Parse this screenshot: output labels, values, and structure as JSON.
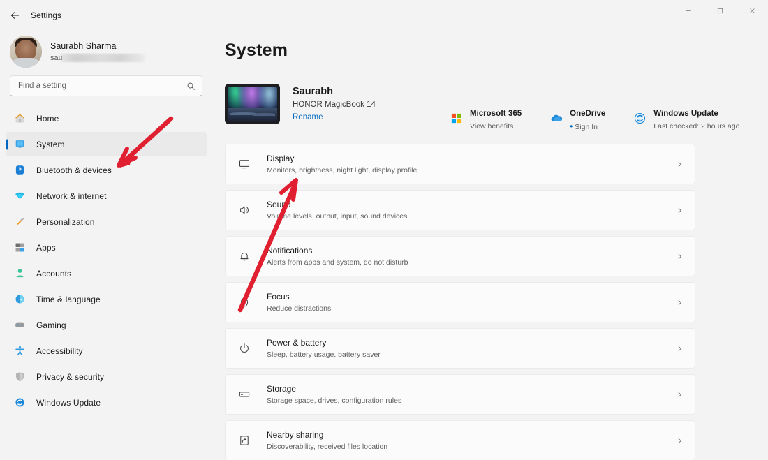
{
  "titlebar": {
    "back_label": "back-arrow",
    "title": "Settings",
    "minimize": "–",
    "maximize": "❐",
    "close": "✕"
  },
  "sidebar": {
    "profile": {
      "name": "Saurabh Sharma",
      "email_visible_prefix": "sau",
      "email_visible_suffix": "n"
    },
    "search": {
      "placeholder": "Find a setting",
      "icon": "search-icon"
    },
    "items": [
      {
        "label": "Home",
        "icon": "home-icon",
        "selected": false
      },
      {
        "label": "System",
        "icon": "system-monitor-icon",
        "selected": true
      },
      {
        "label": "Bluetooth & devices",
        "icon": "bluetooth-icon",
        "selected": false
      },
      {
        "label": "Network & internet",
        "icon": "wifi-icon",
        "selected": false
      },
      {
        "label": "Personalization",
        "icon": "paintbrush-icon",
        "selected": false
      },
      {
        "label": "Apps",
        "icon": "apps-grid-icon",
        "selected": false
      },
      {
        "label": "Accounts",
        "icon": "person-icon",
        "selected": false
      },
      {
        "label": "Time & language",
        "icon": "clock-globe-icon",
        "selected": false
      },
      {
        "label": "Gaming",
        "icon": "game-controller-icon",
        "selected": false
      },
      {
        "label": "Accessibility",
        "icon": "accessibility-person-icon",
        "selected": false
      },
      {
        "label": "Privacy & security",
        "icon": "shield-icon",
        "selected": false
      },
      {
        "label": "Windows Update",
        "icon": "update-arrows-icon",
        "selected": false
      }
    ]
  },
  "main": {
    "page_title": "System",
    "device": {
      "name": "Saurabh",
      "model": "HONOR MagicBook 14",
      "rename_label": "Rename",
      "thumbnail": "aurora-wallpaper-laptop-thumbnail"
    },
    "status_tiles": [
      {
        "title": "Microsoft 365",
        "subtitle": "View benefits",
        "icon": "microsoft-365-logo-icon"
      },
      {
        "title": "OneDrive",
        "subtitle": "Sign In",
        "icon": "onedrive-cloud-icon",
        "has_dot": true
      },
      {
        "title": "Windows Update",
        "subtitle": "Last checked: 2 hours ago",
        "icon": "windows-update-icon"
      }
    ],
    "rows": [
      {
        "title": "Display",
        "subtitle": "Monitors, brightness, night light, display profile",
        "icon": "display-monitor-icon"
      },
      {
        "title": "Sound",
        "subtitle": "Volume levels, output, input, sound devices",
        "icon": "sound-speaker-icon"
      },
      {
        "title": "Notifications",
        "subtitle": "Alerts from apps and system, do not disturb",
        "icon": "bell-icon"
      },
      {
        "title": "Focus",
        "subtitle": "Reduce distractions",
        "icon": "focus-crescent-icon"
      },
      {
        "title": "Power & battery",
        "subtitle": "Sleep, battery usage, battery saver",
        "icon": "power-icon"
      },
      {
        "title": "Storage",
        "subtitle": "Storage space, drives, configuration rules",
        "icon": "storage-drive-icon"
      },
      {
        "title": "Nearby sharing",
        "subtitle": "Discoverability, received files location",
        "icon": "nearby-share-icon"
      }
    ]
  },
  "annotations": {
    "arrow_color": "#e02030",
    "arrows": [
      {
        "name": "arrow-to-system-sidebar-item",
        "points_to": "System"
      },
      {
        "name": "arrow-to-display-row",
        "points_to": "Display"
      }
    ]
  },
  "colors": {
    "accent": "#0067c0",
    "page_bg": "#f3f3f3",
    "card_bg": "#fbfbfb",
    "selected_bg": "#eaeaea"
  }
}
